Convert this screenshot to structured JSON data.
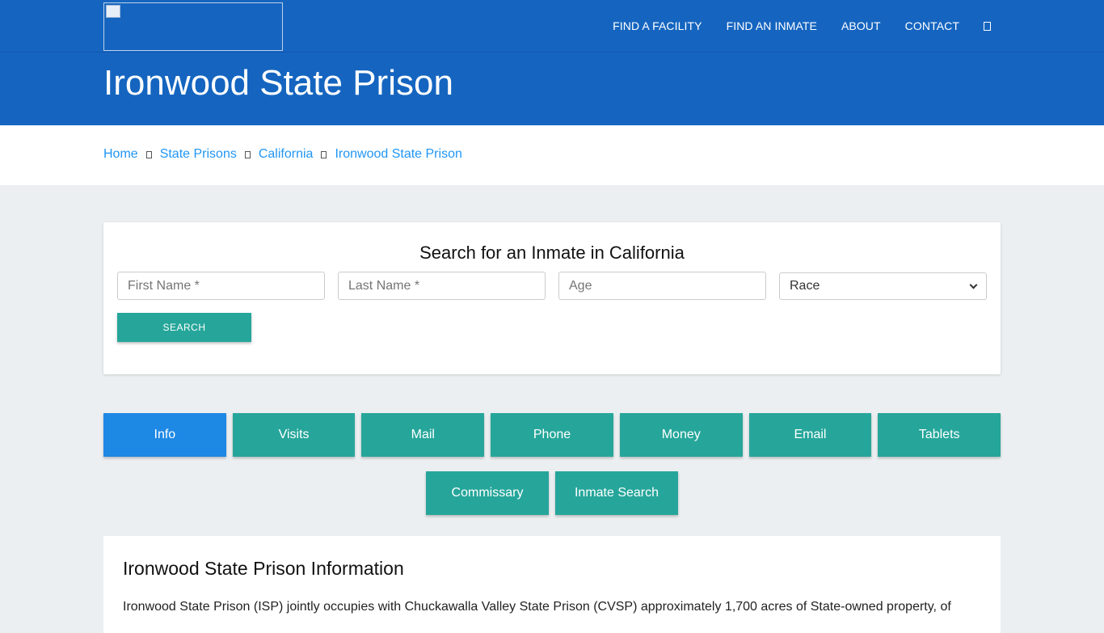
{
  "header": {
    "logo_alt": "",
    "nav": [
      {
        "label": "FIND A FACILITY"
      },
      {
        "label": "FIND AN INMATE"
      },
      {
        "label": "ABOUT"
      },
      {
        "label": "CONTACT"
      }
    ],
    "search_icon": "search-icon",
    "page_title": "Ironwood State Prison"
  },
  "breadcrumb": [
    {
      "label": "Home"
    },
    {
      "label": "State Prisons"
    },
    {
      "label": "California"
    },
    {
      "label": "Ironwood State Prison"
    }
  ],
  "search": {
    "title": "Search for an Inmate in California",
    "first_name_placeholder": "First Name *",
    "last_name_placeholder": "Last Name *",
    "age_placeholder": "Age",
    "race_selected": "Race",
    "button_label": "SEARCH"
  },
  "tabs_row1": [
    "Info",
    "Visits",
    "Mail",
    "Phone",
    "Money",
    "Email",
    "Tablets"
  ],
  "tabs_row2": [
    "Commissary",
    "Inmate Search"
  ],
  "active_tab": "Info",
  "info": {
    "title": "Ironwood State Prison Information",
    "text": "Ironwood State Prison (ISP) jointly occupies with Chuckawalla Valley State Prison (CVSP) approximately 1,700 acres of State-owned property, of"
  },
  "colors": {
    "header_blue": "#1565c0",
    "teal": "#26a69a",
    "active_blue": "#1e88e5",
    "link_blue": "#2196f3"
  }
}
